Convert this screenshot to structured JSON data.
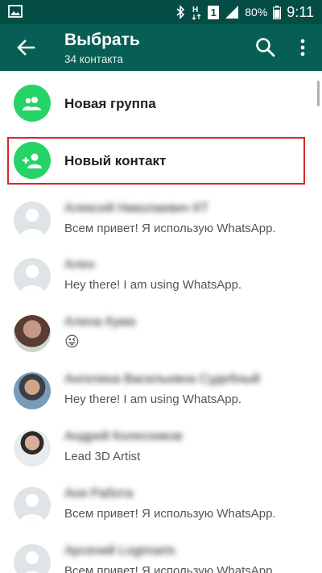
{
  "statusbar": {
    "battery_percent": "80%",
    "time": "9:11",
    "sim_label": "1",
    "network_label": "H"
  },
  "appbar": {
    "title": "Выбрать",
    "subtitle": "34 контакта"
  },
  "actions": {
    "new_group": "Новая группа",
    "new_contact": "Новый контакт"
  },
  "contacts": [
    {
      "name": "Алексей Николаевич КТ",
      "status": "Всем привет! Я использую WhatsApp."
    },
    {
      "name": "Ален",
      "status": "Hey there! I am using WhatsApp."
    },
    {
      "name": "Алена Кума",
      "status": "😜"
    },
    {
      "name": "Ангелина Васильевна Судебный",
      "status": "Hey there! I am using WhatsApp."
    },
    {
      "name": "Андрей Колесников",
      "status": "Lead 3D Artist"
    },
    {
      "name": "Аня Работа",
      "status": "Всем привет! Я использую WhatsApp."
    },
    {
      "name": "Арсений Logimarts",
      "status": "Всем привет! Я использую WhatsApp."
    }
  ],
  "colors": {
    "statusbar": "#054d44",
    "appbar": "#075e54",
    "accent_green": "#25d366",
    "highlight_border": "#d8262c"
  }
}
